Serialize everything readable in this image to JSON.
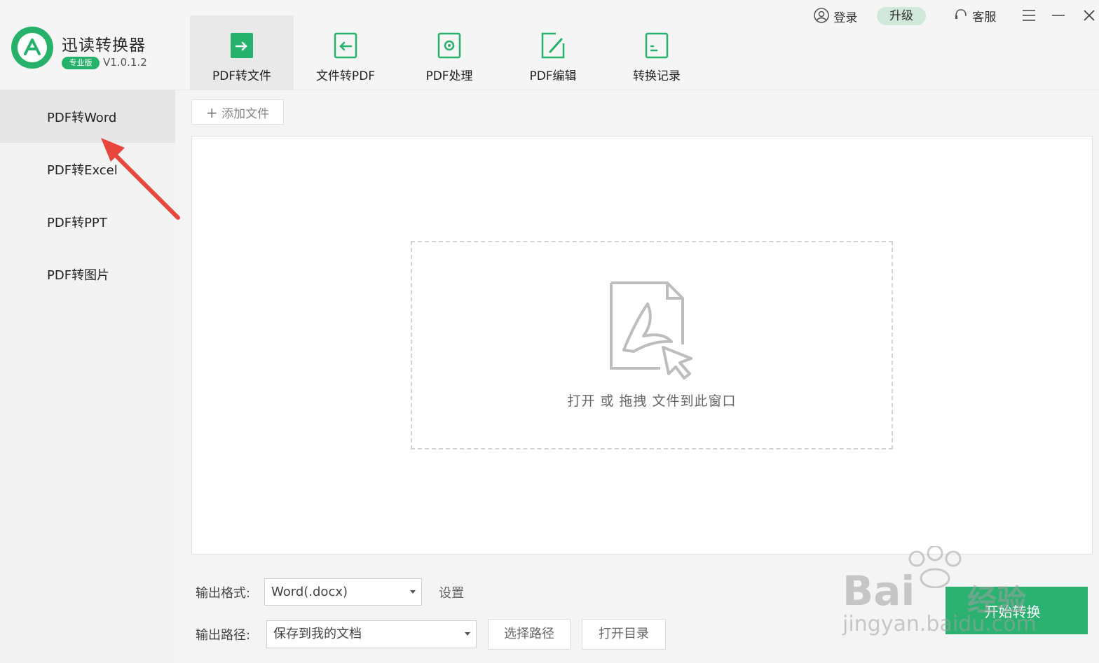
{
  "app": {
    "title": "迅读转换器",
    "edition_badge": "专业版",
    "version": "V1.0.1.2"
  },
  "top_tabs": [
    {
      "label": "PDF转文件",
      "icon": "pdf-to-file-icon",
      "active": true
    },
    {
      "label": "文件转PDF",
      "icon": "file-to-pdf-icon",
      "active": false
    },
    {
      "label": "PDF处理",
      "icon": "pdf-process-icon",
      "active": false
    },
    {
      "label": "PDF编辑",
      "icon": "pdf-edit-icon",
      "active": false
    },
    {
      "label": "转换记录",
      "icon": "history-icon",
      "active": false
    }
  ],
  "header_actions": {
    "login": "登录",
    "upgrade": "升级",
    "support": "客服"
  },
  "sidebar": {
    "items": [
      {
        "label": "PDF转Word",
        "active": true
      },
      {
        "label": "PDF转Excel",
        "active": false
      },
      {
        "label": "PDF转PPT",
        "active": false
      },
      {
        "label": "PDF转图片",
        "active": false
      }
    ]
  },
  "main": {
    "add_file": "添加文件",
    "drop_hint": "打开 或 拖拽 文件到此窗口"
  },
  "output": {
    "format_label": "输出格式:",
    "format_value": "Word(.docx)",
    "settings": "设置",
    "path_label": "输出路径:",
    "path_value": "保存到我的文档",
    "choose_path": "选择路径",
    "open_dir": "打开目录",
    "start": "开始转换"
  },
  "watermark": {
    "brand": "Bai",
    "brand_cn": "经验",
    "url": "jingyan.baidu.com"
  },
  "colors": {
    "brand_green": "#27b26b",
    "start_button": "#2bb271",
    "arrow_red": "#e8453c"
  }
}
